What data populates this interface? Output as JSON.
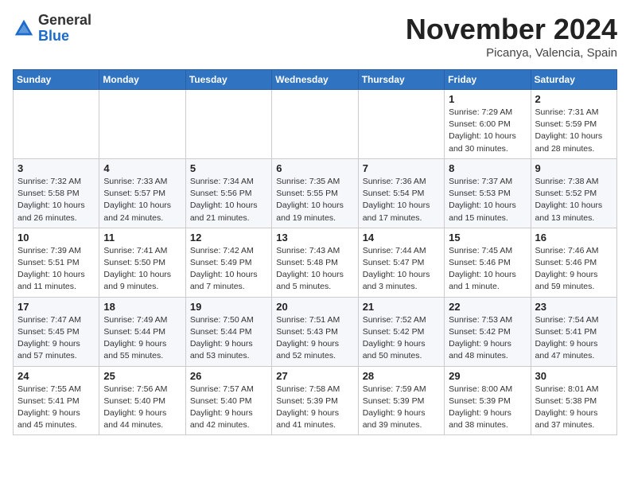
{
  "header": {
    "logo_line1": "General",
    "logo_line2": "Blue",
    "month": "November 2024",
    "location": "Picanya, Valencia, Spain"
  },
  "weekdays": [
    "Sunday",
    "Monday",
    "Tuesday",
    "Wednesday",
    "Thursday",
    "Friday",
    "Saturday"
  ],
  "weeks": [
    [
      {
        "day": "",
        "info": ""
      },
      {
        "day": "",
        "info": ""
      },
      {
        "day": "",
        "info": ""
      },
      {
        "day": "",
        "info": ""
      },
      {
        "day": "",
        "info": ""
      },
      {
        "day": "1",
        "info": "Sunrise: 7:29 AM\nSunset: 6:00 PM\nDaylight: 10 hours\nand 30 minutes."
      },
      {
        "day": "2",
        "info": "Sunrise: 7:31 AM\nSunset: 5:59 PM\nDaylight: 10 hours\nand 28 minutes."
      }
    ],
    [
      {
        "day": "3",
        "info": "Sunrise: 7:32 AM\nSunset: 5:58 PM\nDaylight: 10 hours\nand 26 minutes."
      },
      {
        "day": "4",
        "info": "Sunrise: 7:33 AM\nSunset: 5:57 PM\nDaylight: 10 hours\nand 24 minutes."
      },
      {
        "day": "5",
        "info": "Sunrise: 7:34 AM\nSunset: 5:56 PM\nDaylight: 10 hours\nand 21 minutes."
      },
      {
        "day": "6",
        "info": "Sunrise: 7:35 AM\nSunset: 5:55 PM\nDaylight: 10 hours\nand 19 minutes."
      },
      {
        "day": "7",
        "info": "Sunrise: 7:36 AM\nSunset: 5:54 PM\nDaylight: 10 hours\nand 17 minutes."
      },
      {
        "day": "8",
        "info": "Sunrise: 7:37 AM\nSunset: 5:53 PM\nDaylight: 10 hours\nand 15 minutes."
      },
      {
        "day": "9",
        "info": "Sunrise: 7:38 AM\nSunset: 5:52 PM\nDaylight: 10 hours\nand 13 minutes."
      }
    ],
    [
      {
        "day": "10",
        "info": "Sunrise: 7:39 AM\nSunset: 5:51 PM\nDaylight: 10 hours\nand 11 minutes."
      },
      {
        "day": "11",
        "info": "Sunrise: 7:41 AM\nSunset: 5:50 PM\nDaylight: 10 hours\nand 9 minutes."
      },
      {
        "day": "12",
        "info": "Sunrise: 7:42 AM\nSunset: 5:49 PM\nDaylight: 10 hours\nand 7 minutes."
      },
      {
        "day": "13",
        "info": "Sunrise: 7:43 AM\nSunset: 5:48 PM\nDaylight: 10 hours\nand 5 minutes."
      },
      {
        "day": "14",
        "info": "Sunrise: 7:44 AM\nSunset: 5:47 PM\nDaylight: 10 hours\nand 3 minutes."
      },
      {
        "day": "15",
        "info": "Sunrise: 7:45 AM\nSunset: 5:46 PM\nDaylight: 10 hours\nand 1 minute."
      },
      {
        "day": "16",
        "info": "Sunrise: 7:46 AM\nSunset: 5:46 PM\nDaylight: 9 hours\nand 59 minutes."
      }
    ],
    [
      {
        "day": "17",
        "info": "Sunrise: 7:47 AM\nSunset: 5:45 PM\nDaylight: 9 hours\nand 57 minutes."
      },
      {
        "day": "18",
        "info": "Sunrise: 7:49 AM\nSunset: 5:44 PM\nDaylight: 9 hours\nand 55 minutes."
      },
      {
        "day": "19",
        "info": "Sunrise: 7:50 AM\nSunset: 5:44 PM\nDaylight: 9 hours\nand 53 minutes."
      },
      {
        "day": "20",
        "info": "Sunrise: 7:51 AM\nSunset: 5:43 PM\nDaylight: 9 hours\nand 52 minutes."
      },
      {
        "day": "21",
        "info": "Sunrise: 7:52 AM\nSunset: 5:42 PM\nDaylight: 9 hours\nand 50 minutes."
      },
      {
        "day": "22",
        "info": "Sunrise: 7:53 AM\nSunset: 5:42 PM\nDaylight: 9 hours\nand 48 minutes."
      },
      {
        "day": "23",
        "info": "Sunrise: 7:54 AM\nSunset: 5:41 PM\nDaylight: 9 hours\nand 47 minutes."
      }
    ],
    [
      {
        "day": "24",
        "info": "Sunrise: 7:55 AM\nSunset: 5:41 PM\nDaylight: 9 hours\nand 45 minutes."
      },
      {
        "day": "25",
        "info": "Sunrise: 7:56 AM\nSunset: 5:40 PM\nDaylight: 9 hours\nand 44 minutes."
      },
      {
        "day": "26",
        "info": "Sunrise: 7:57 AM\nSunset: 5:40 PM\nDaylight: 9 hours\nand 42 minutes."
      },
      {
        "day": "27",
        "info": "Sunrise: 7:58 AM\nSunset: 5:39 PM\nDaylight: 9 hours\nand 41 minutes."
      },
      {
        "day": "28",
        "info": "Sunrise: 7:59 AM\nSunset: 5:39 PM\nDaylight: 9 hours\nand 39 minutes."
      },
      {
        "day": "29",
        "info": "Sunrise: 8:00 AM\nSunset: 5:39 PM\nDaylight: 9 hours\nand 38 minutes."
      },
      {
        "day": "30",
        "info": "Sunrise: 8:01 AM\nSunset: 5:38 PM\nDaylight: 9 hours\nand 37 minutes."
      }
    ]
  ]
}
